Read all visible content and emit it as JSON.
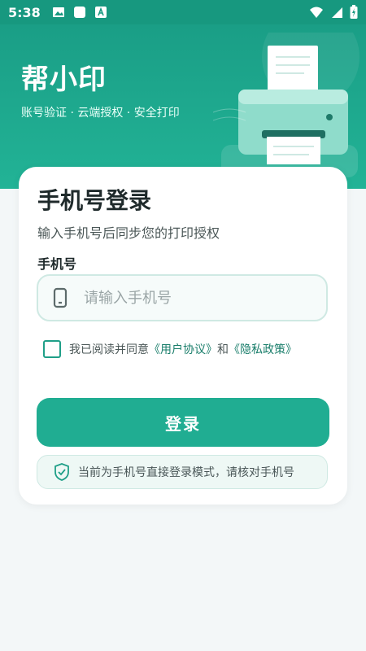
{
  "status_bar": {
    "time": "5:38"
  },
  "header": {
    "title": "帮小印",
    "subtitle": "账号验证 · 云端授权 · 安全打印"
  },
  "login_card": {
    "title": "手机号登录",
    "subtitle": "输入手机号后同步您的打印授权",
    "phone_label": "手机号",
    "phone_placeholder": "请输入手机号",
    "phone_value": "",
    "agreement_prefix": "我已阅读并同意",
    "user_agreement": "《用户协议》",
    "agreement_and": "和",
    "privacy_policy": "《隐私政策》",
    "login_button": "登录",
    "notice": "当前为手机号直接登录模式，请核对手机号"
  },
  "colors": {
    "brand": "#1f9f88",
    "button": "#20ad92",
    "background": "#f3f7f8"
  }
}
